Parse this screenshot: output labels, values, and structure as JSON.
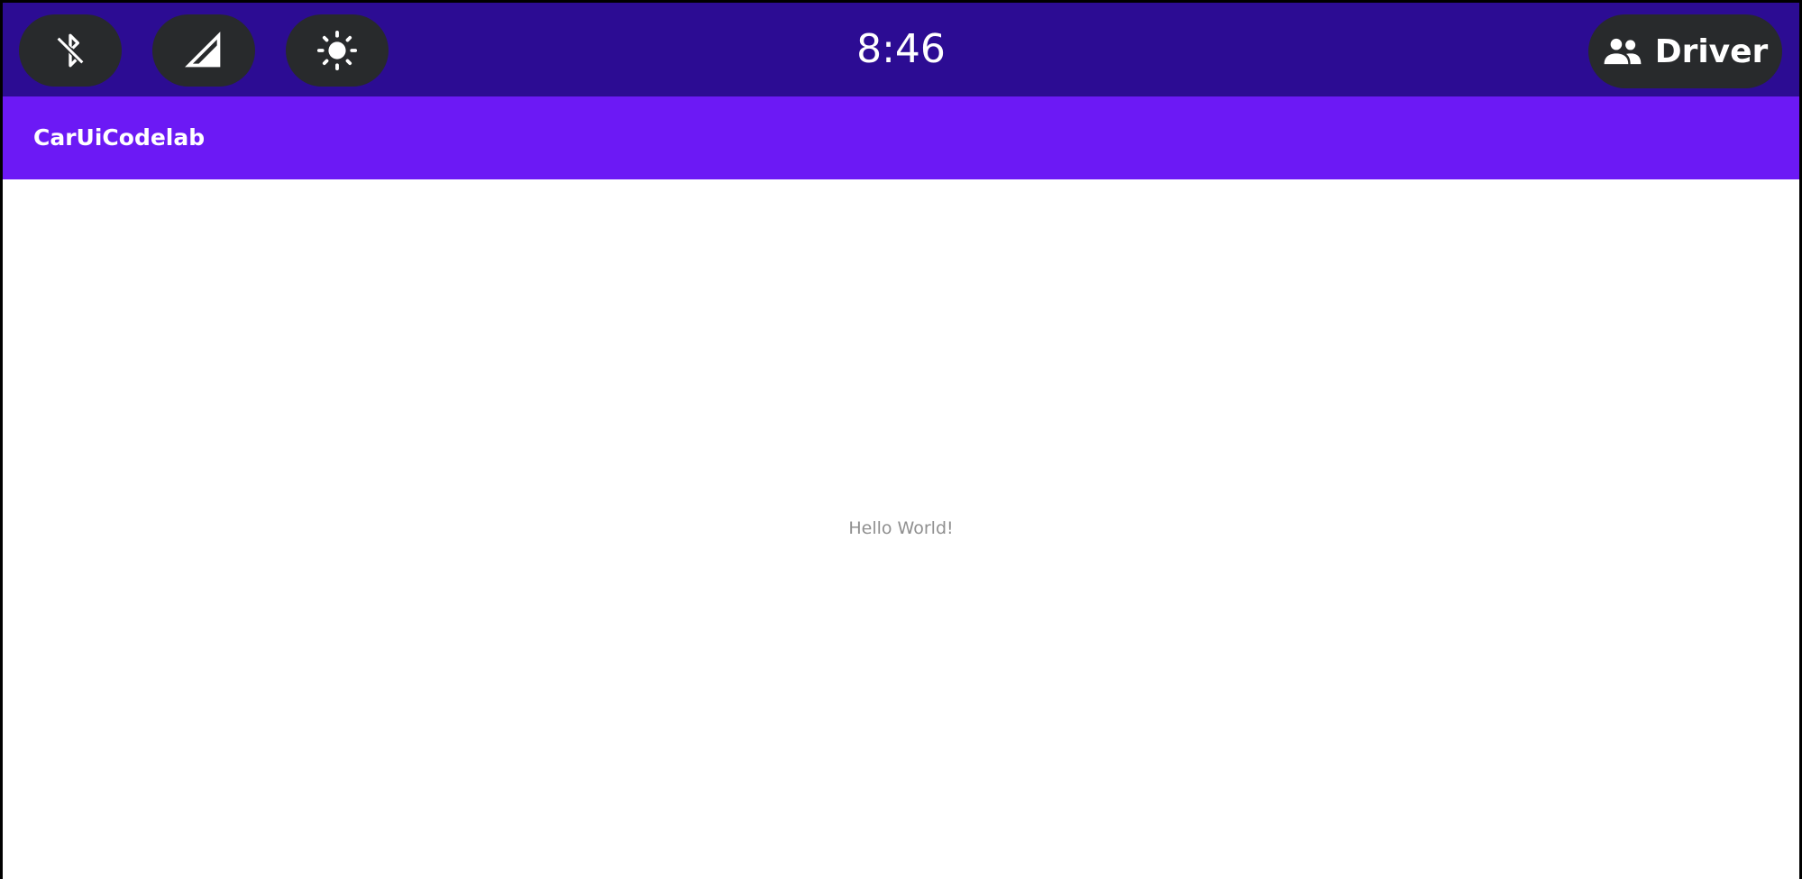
{
  "status_bar": {
    "clock": "8:46",
    "user_label": "Driver",
    "background": "#2c0c93",
    "button_background": "#282a2c",
    "quick_settings": [
      {
        "icon": "bluetooth-off-icon"
      },
      {
        "icon": "cellular-signal-icon"
      },
      {
        "icon": "brightness-icon"
      }
    ],
    "user_icon": "people-icon"
  },
  "app_bar": {
    "title": "CarUiCodelab",
    "background": "#6c19f5"
  },
  "content": {
    "message": "Hello World!"
  }
}
